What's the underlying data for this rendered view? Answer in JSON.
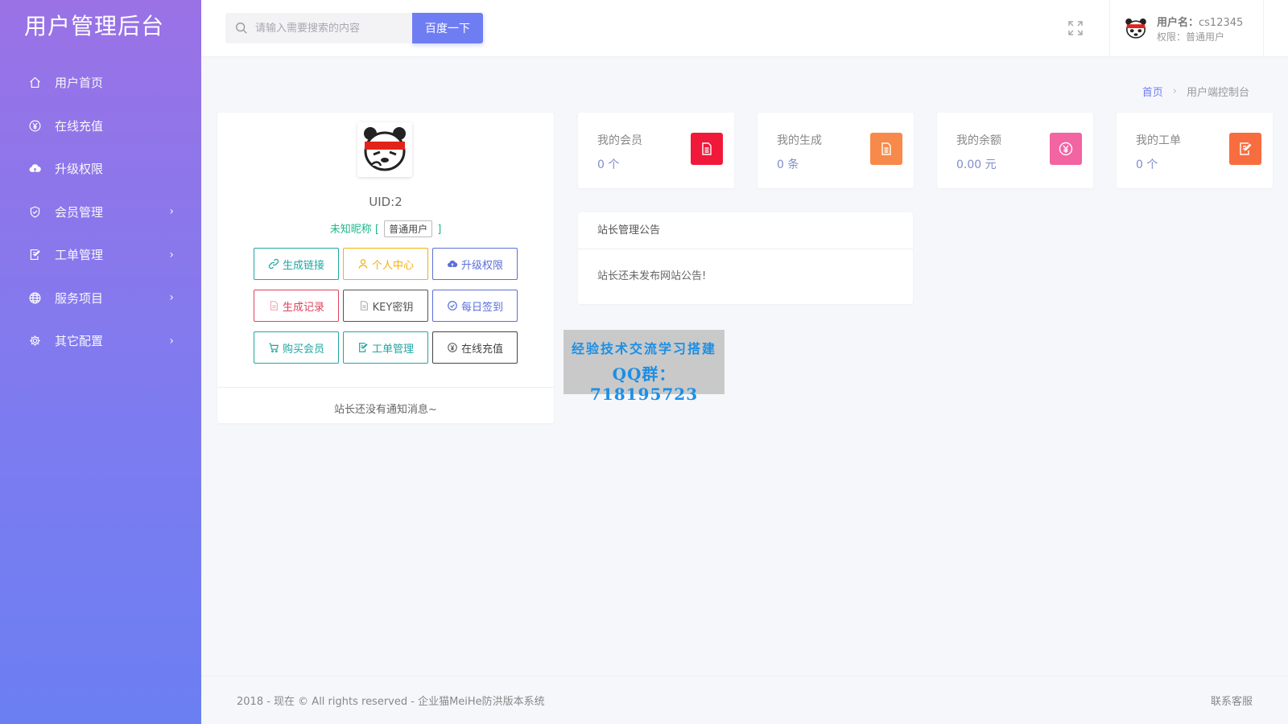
{
  "brand": "用户管理后台",
  "sidebar": {
    "items": [
      {
        "label": "用户首页",
        "icon": "home-icon",
        "has_children": false
      },
      {
        "label": "在线充值",
        "icon": "yen-circle-icon",
        "has_children": false
      },
      {
        "label": "升级权限",
        "icon": "cloud-upload-icon",
        "has_children": false
      },
      {
        "label": "会员管理",
        "icon": "shield-check-icon",
        "has_children": true
      },
      {
        "label": "工单管理",
        "icon": "edit-note-icon",
        "has_children": true
      },
      {
        "label": "服务项目",
        "icon": "globe-icon",
        "has_children": true
      },
      {
        "label": "其它配置",
        "icon": "gear-icon",
        "has_children": true
      }
    ]
  },
  "header": {
    "search_placeholder": "请输入需要搜索的内容",
    "search_button": "百度一下",
    "user_name_label": "用户名：",
    "user_name": "cs12345",
    "user_role": "权限：普通用户"
  },
  "breadcrumb": {
    "home": "首页",
    "current": "用户端控制台"
  },
  "profile": {
    "uid": "UID:2",
    "nickname_prefix": "未知昵称 [",
    "role_badge": "普通用户",
    "nickname_suffix": "]",
    "buttons": [
      {
        "label": "生成链接",
        "icon": "link-icon",
        "color": "#1fa7a1"
      },
      {
        "label": "个人中心",
        "icon": "user-icon",
        "color": "#f5b10c"
      },
      {
        "label": "升级权限",
        "icon": "cloud-upload-icon",
        "color": "#5b6fd8"
      },
      {
        "label": "生成记录",
        "icon": "document-icon",
        "color": "#e0405a"
      },
      {
        "label": "KEY密钥",
        "icon": "document-icon",
        "color": "#555555"
      },
      {
        "label": "每日签到",
        "icon": "check-circle-icon",
        "color": "#5b6fd8"
      },
      {
        "label": "购买会员",
        "icon": "cart-icon",
        "color": "#1fa7a1"
      },
      {
        "label": "工单管理",
        "icon": "edit-note-icon",
        "color": "#1fa7a1"
      },
      {
        "label": "在线充值",
        "icon": "yen-circle-icon",
        "color": "#444444"
      }
    ],
    "notice": "站长还没有通知消息~"
  },
  "stats": [
    {
      "title": "我的会员",
      "value": "0 个",
      "icon": "document-icon",
      "color": "#f0193a"
    },
    {
      "title": "我的生成",
      "value": "0 条",
      "icon": "document-icon",
      "color": "#f78a4a"
    },
    {
      "title": "我的余额",
      "value": "0.00 元",
      "icon": "yen-circle-icon",
      "color": "#f264a2"
    },
    {
      "title": "我的工单",
      "value": "0 个",
      "icon": "edit-note-icon",
      "color": "#f76d3f"
    }
  ],
  "announcement": {
    "title": "站长管理公告",
    "body": "站长还未发布网站公告!"
  },
  "overlay": {
    "line1": "经验技术交流学习搭建",
    "line2": "QQ群：718195723"
  },
  "footer": {
    "copyright": "2018 - 现在 © All rights reserved - 企业猫MeiHe防洪版本系统",
    "contact": "联系客服"
  }
}
